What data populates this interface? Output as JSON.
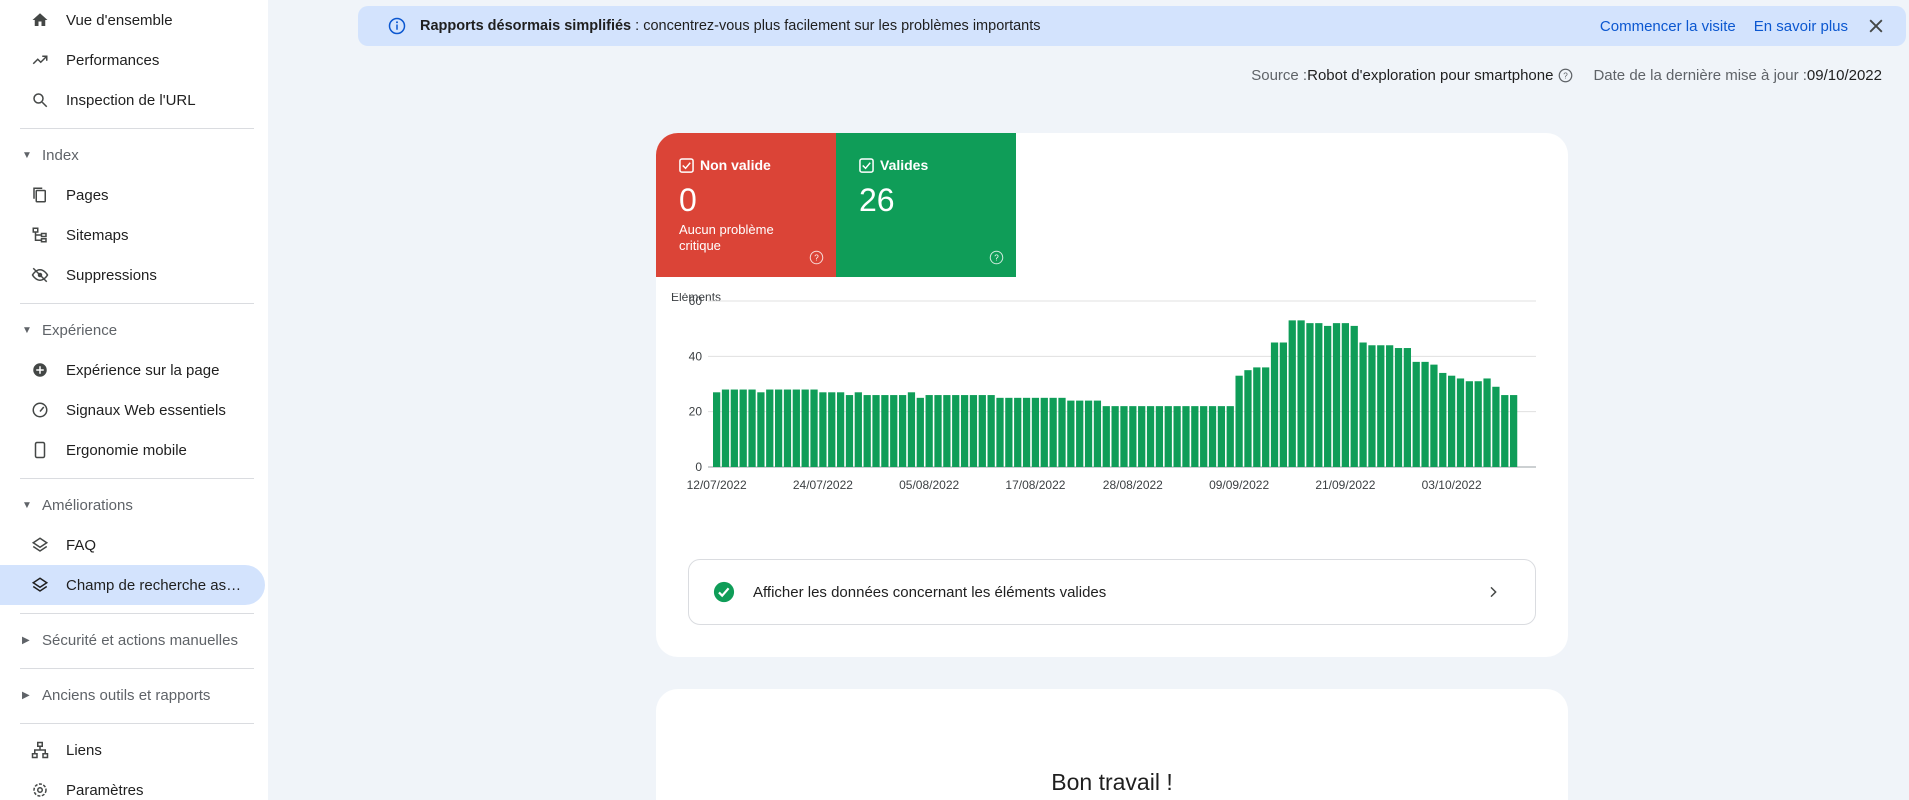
{
  "sidebar": {
    "overview": "Vue d'ensemble",
    "performance": "Performances",
    "url_inspection": "Inspection de l'URL",
    "index_section": "Index",
    "pages": "Pages",
    "sitemaps": "Sitemaps",
    "removals": "Suppressions",
    "experience_section": "Expérience",
    "page_experience": "Expérience sur la page",
    "core_web_vitals": "Signaux Web essentiels",
    "mobile_usability": "Ergonomie mobile",
    "enhancements_section": "Améliorations",
    "faq": "FAQ",
    "sitelinks_search": "Champ de recherche associé aux liens sitelinks",
    "security_section": "Sécurité et actions manuelles",
    "legacy_section": "Anciens outils et rapports",
    "links": "Liens",
    "settings": "Paramètres"
  },
  "banner": {
    "bold": "Rapports désormais simplifiés",
    "text": " : concentrez-vous plus facilement sur les problèmes importants",
    "start_tour": "Commencer la visite",
    "learn_more": "En savoir plus"
  },
  "source": {
    "label": "Source : ",
    "value": "Robot d'exploration pour smartphone",
    "updated_label": "Date de la dernière mise à jour : ",
    "updated_value": "09/10/2022"
  },
  "tiles": {
    "invalid_label": "Non valide",
    "invalid_count": "0",
    "invalid_sub": "Aucun problème critique",
    "valid_label": "Valides",
    "valid_count": "26"
  },
  "colors": {
    "invalid": "#db4437",
    "valid": "#0f9d58",
    "accent": "#0b57d0"
  },
  "chart_data": {
    "type": "bar",
    "ylabel": "Éléments",
    "ylim": [
      0,
      60
    ],
    "yticks": [
      0,
      20,
      40,
      60
    ],
    "xticks": [
      "12/07/2022",
      "24/07/2022",
      "05/08/2022",
      "17/08/2022",
      "28/08/2022",
      "09/09/2022",
      "21/09/2022",
      "03/10/2022"
    ],
    "xtick_index": [
      0,
      12,
      24,
      36,
      47,
      59,
      71,
      83
    ],
    "color": "#0f9d58",
    "values": [
      27,
      28,
      28,
      28,
      28,
      27,
      28,
      28,
      28,
      28,
      28,
      28,
      27,
      27,
      27,
      26,
      27,
      26,
      26,
      26,
      26,
      26,
      27,
      25,
      26,
      26,
      26,
      26,
      26,
      26,
      26,
      26,
      25,
      25,
      25,
      25,
      25,
      25,
      25,
      25,
      24,
      24,
      24,
      24,
      22,
      22,
      22,
      22,
      22,
      22,
      22,
      22,
      22,
      22,
      22,
      22,
      22,
      22,
      22,
      33,
      35,
      36,
      36,
      45,
      45,
      53,
      53,
      52,
      52,
      51,
      52,
      52,
      51,
      45,
      44,
      44,
      44,
      43,
      43,
      38,
      38,
      37,
      34,
      33,
      32,
      31,
      31,
      32,
      29,
      26,
      26
    ]
  },
  "valid_row": {
    "text": "Afficher les données concernant les éléments valides"
  },
  "card2": {
    "title": "Bon travail !"
  }
}
